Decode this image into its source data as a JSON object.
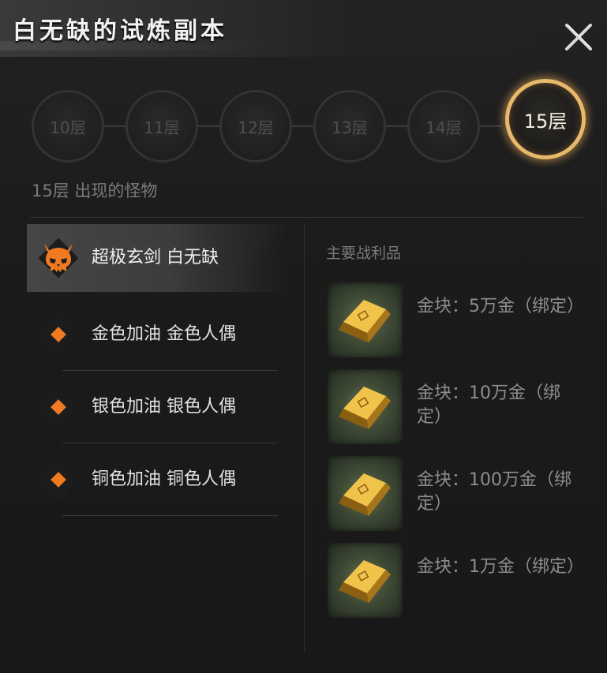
{
  "header": {
    "title": "白无缺的试炼副本",
    "close_icon": "close-icon"
  },
  "floors": [
    {
      "label": "10层",
      "active": false
    },
    {
      "label": "11层",
      "active": false
    },
    {
      "label": "12层",
      "active": false
    },
    {
      "label": "13层",
      "active": false
    },
    {
      "label": "14层",
      "active": false
    },
    {
      "label": "15层",
      "active": true
    }
  ],
  "floor_subtitle": "15层 出现的怪物",
  "monsters": [
    {
      "name": "超极玄剑 白无缺",
      "icon": "boss-skull-icon",
      "selected": true
    },
    {
      "name": "金色加油 金色人偶",
      "icon": "orange-diamond-icon",
      "selected": false
    },
    {
      "name": "银色加油 银色人偶",
      "icon": "orange-diamond-icon",
      "selected": false
    },
    {
      "name": "铜色加油 铜色人偶",
      "icon": "orange-diamond-icon",
      "selected": false
    }
  ],
  "loot": {
    "title": "主要战利品",
    "items": [
      {
        "text": "金块：5万金（绑定）",
        "icon": "gold-bar-icon"
      },
      {
        "text": "金块：10万金（绑定）",
        "icon": "gold-bar-icon"
      },
      {
        "text": "金块：100万金（绑定）",
        "icon": "gold-bar-icon"
      },
      {
        "text": "金块：1万金（绑定）",
        "icon": "gold-bar-icon"
      }
    ]
  },
  "colors": {
    "accent_ring": "#e8b86b",
    "monster_marker": "#f07a22",
    "background": "#1b1b1b"
  }
}
